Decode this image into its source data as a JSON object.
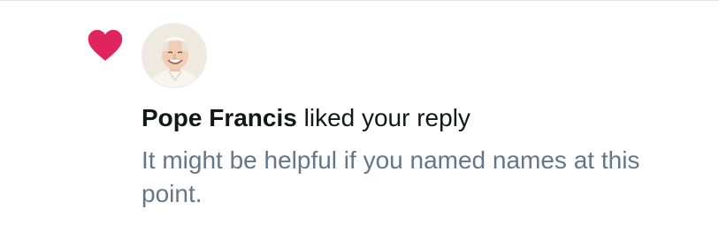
{
  "notification": {
    "icon": "heart-icon",
    "icon_color": "#e0245e",
    "actor_name": "Pope Francis",
    "action_text": " liked your reply",
    "reply_text": "It might be helpful if you named names at this point."
  },
  "colors": {
    "primary_text": "#14171a",
    "secondary_text": "#657786",
    "divider": "#e1e8ed"
  }
}
